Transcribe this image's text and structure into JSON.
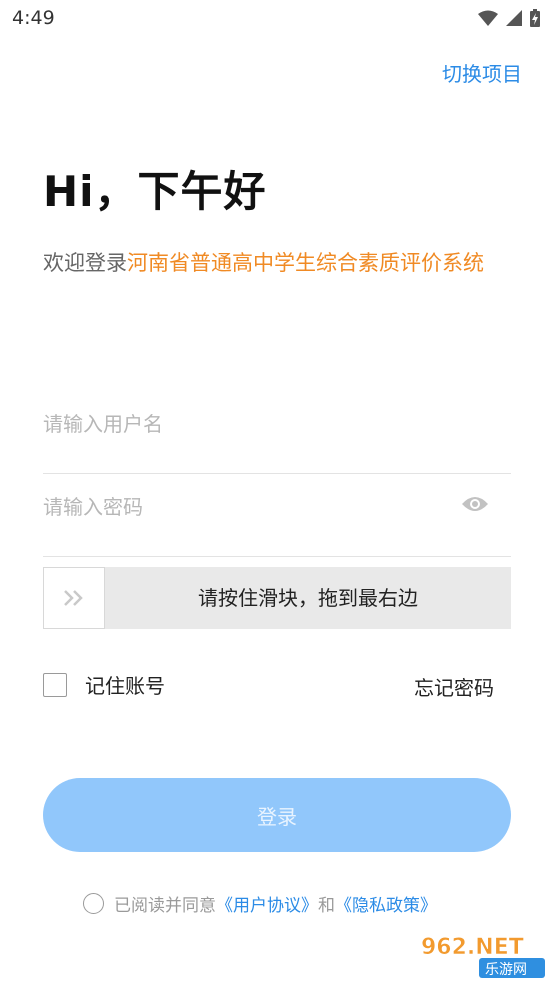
{
  "status_bar": {
    "time": "4:49"
  },
  "header": {
    "switch_project": "切换项目"
  },
  "greeting": "Hi，下午好",
  "welcome": {
    "prefix": "欢迎登录",
    "system_name": "河南省普通高中学生综合素质评价系统"
  },
  "form": {
    "username_placeholder": "请输入用户名",
    "password_placeholder": "请输入密码",
    "slider_text": "请按住滑块，拖到最右边",
    "remember_label": "记住账号",
    "forgot_label": "忘记密码",
    "login_label": "登录"
  },
  "agreement": {
    "prefix": "已阅读并同意",
    "user_agreement": "《用户协议》",
    "and": "和",
    "privacy_policy": "《隐私政策》"
  },
  "watermark": {
    "brand": "962.NET",
    "sub": "乐游网"
  },
  "colors": {
    "accent_blue": "#2b8be6",
    "orange": "#f08a24",
    "login_button": "#91c7fb"
  }
}
